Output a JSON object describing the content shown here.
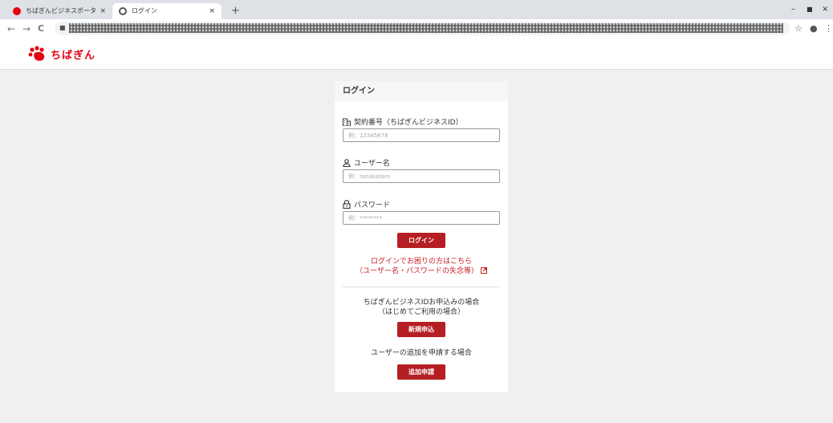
{
  "browser": {
    "tabs": [
      {
        "label": "ちばぎんビジネスポータル | 千葉銀行",
        "close": "×"
      },
      {
        "label": "ログイン",
        "close": "×"
      }
    ],
    "new_tab": "+",
    "window_controls": {
      "minimize": "–",
      "maximize": "■",
      "close": "×"
    },
    "nav": {
      "back": "←",
      "forward": "→",
      "reload": "C"
    },
    "toolbar_icons": {
      "star": "☆",
      "profile": "●",
      "menu": "⋮"
    }
  },
  "header": {
    "logo_text": "ちばぎん"
  },
  "login": {
    "title": "ログイン",
    "contract": {
      "label": "契約番号（ちばぎんビジネスID）",
      "placeholder": "例：12345678"
    },
    "username": {
      "label": "ユーザー名",
      "placeholder": "例：tanakataro"
    },
    "password": {
      "label": "パスワード",
      "placeholder": "例：********"
    },
    "login_button": "ログイン",
    "help_link": {
      "line1": "ログインでお困りの方はこちら",
      "line2": "（ユーザー名・パスワードの失念等）"
    },
    "new_apply": {
      "line1": "ちばぎんビジネスIDお申込みの場合",
      "line2": "（はじめてご利用の場合）",
      "button": "新規申込"
    },
    "add_apply": {
      "text": "ユーザーの追加を申請する場合",
      "button": "追加申請"
    }
  },
  "colors": {
    "brand": "#e60012",
    "button": "#b51f24",
    "link": "#c81e24"
  }
}
